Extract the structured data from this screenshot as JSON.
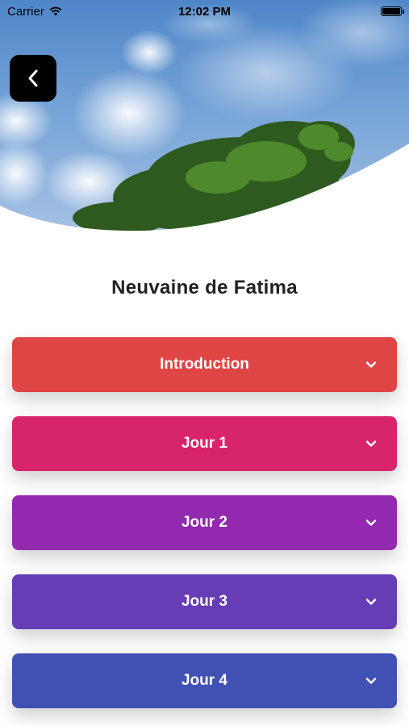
{
  "status_bar": {
    "carrier": "Carrier",
    "time": "12:02 PM"
  },
  "header": {
    "back_icon": "chevron-left-icon",
    "title": "Neuvaine de Fatima"
  },
  "sections": [
    {
      "label": "Introduction",
      "color": "#E04545",
      "expanded": false
    },
    {
      "label": "Jour 1",
      "color": "#D8246A",
      "expanded": false
    },
    {
      "label": "Jour 2",
      "color": "#9329AF",
      "expanded": false
    },
    {
      "label": "Jour 3",
      "color": "#663DB5",
      "expanded": false
    },
    {
      "label": "Jour 4",
      "color": "#4150B3",
      "expanded": false
    }
  ]
}
